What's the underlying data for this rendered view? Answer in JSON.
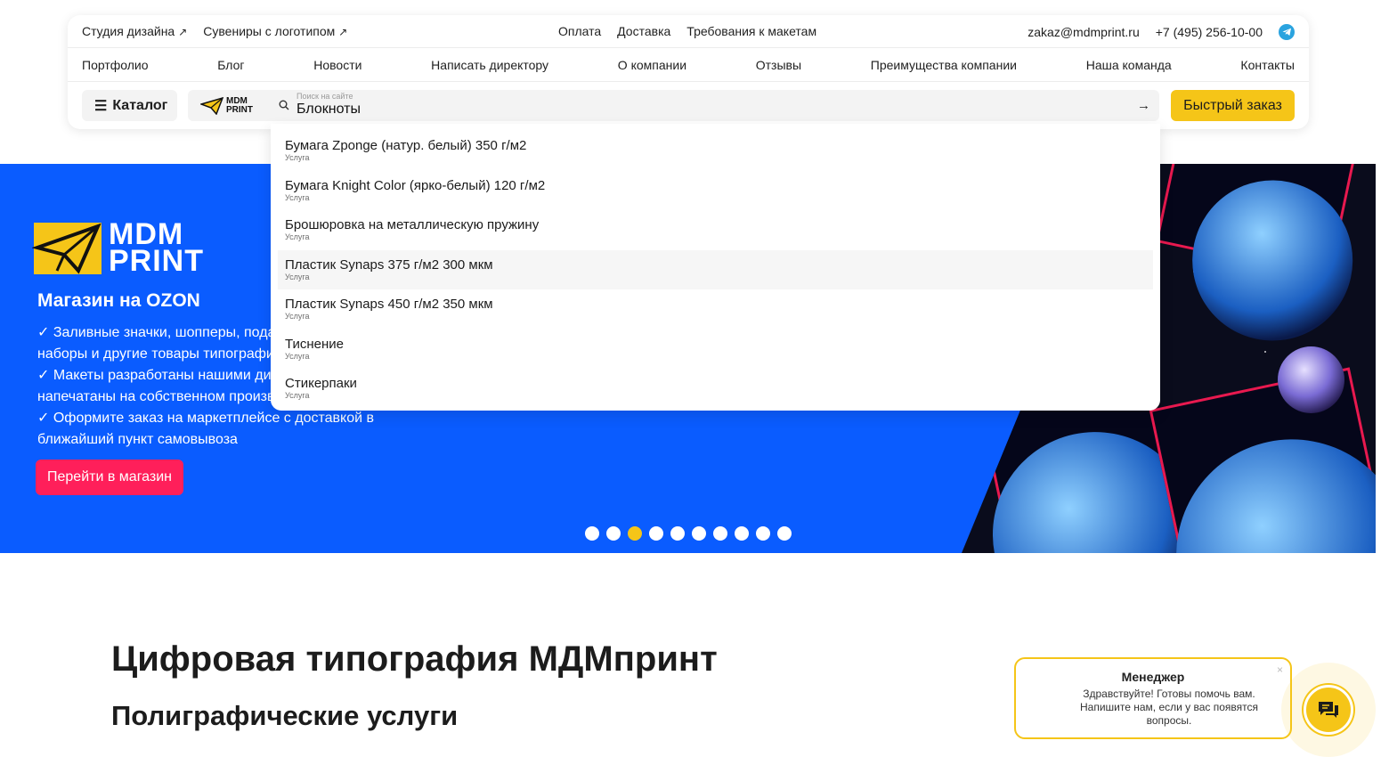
{
  "topbar": {
    "left_links": [
      "Студия дизайна",
      "Сувениры с логотипом"
    ],
    "center_links": [
      "Оплата",
      "Доставка",
      "Требования к макетам"
    ],
    "email": "zakaz@mdmprint.ru",
    "phone": "+7 (495) 256-10-00"
  },
  "nav": {
    "items": [
      "Портфолио",
      "Блог",
      "Новости",
      "Написать директору",
      "О компании",
      "Отзывы",
      "Преимущества компании",
      "Наша команда",
      "Контакты"
    ]
  },
  "searchbar": {
    "catalog_label": "Каталог",
    "logo_text_line1": "MDM",
    "logo_text_line2": "PRINT",
    "placeholder": "Поиск на сайте",
    "value": "Блокноты",
    "quick_order_label": "Быстрый заказ"
  },
  "suggestions": [
    {
      "title": "Бумага Zponge (натур. белый) 350 г/м2",
      "type": "Услуга"
    },
    {
      "title": "Бумага Knight Color (ярко-белый) 120 г/м2",
      "type": "Услуга"
    },
    {
      "title": "Брошюровка на металлическую пружину",
      "type": "Услуга"
    },
    {
      "title": "Пластик Synaps 375 г/м2 300 мкм",
      "type": "Услуга"
    },
    {
      "title": "Пластик Synaps 450 г/м2 350 мкм",
      "type": "Услуга"
    },
    {
      "title": "Тиснение",
      "type": "Услуга"
    },
    {
      "title": "Стикерпаки",
      "type": "Услуга"
    }
  ],
  "hero": {
    "brand_line1": "MDM",
    "brand_line2": "PRINT",
    "heading": "Магазин на OZON",
    "bullets": [
      "✓ Заливные значки, шопперы, подарочные",
      "наборы и другие товары типографии",
      "✓ Макеты разработаны нашими дизайнерами и",
      "напечатаны на собственном производстве",
      "✓ Оформите заказ на маркетплейсе с доставкой в",
      "ближайший пункт самовывоза"
    ],
    "cta_label": "Перейти в магазин",
    "slides_total": 10,
    "active_slide": 3
  },
  "content": {
    "title": "Цифровая типография МДМпринт",
    "subtitle": "Полиграфические услуги"
  },
  "chat": {
    "title": "Менеджер",
    "message": "Здравствуйте! Готовы помочь вам. Напишите нам, если у вас появятся вопросы.",
    "close_glyph": "×"
  },
  "colors": {
    "accent": "#f5c518",
    "hero_bg": "#0a5cff",
    "cta": "#ff1f5a"
  }
}
